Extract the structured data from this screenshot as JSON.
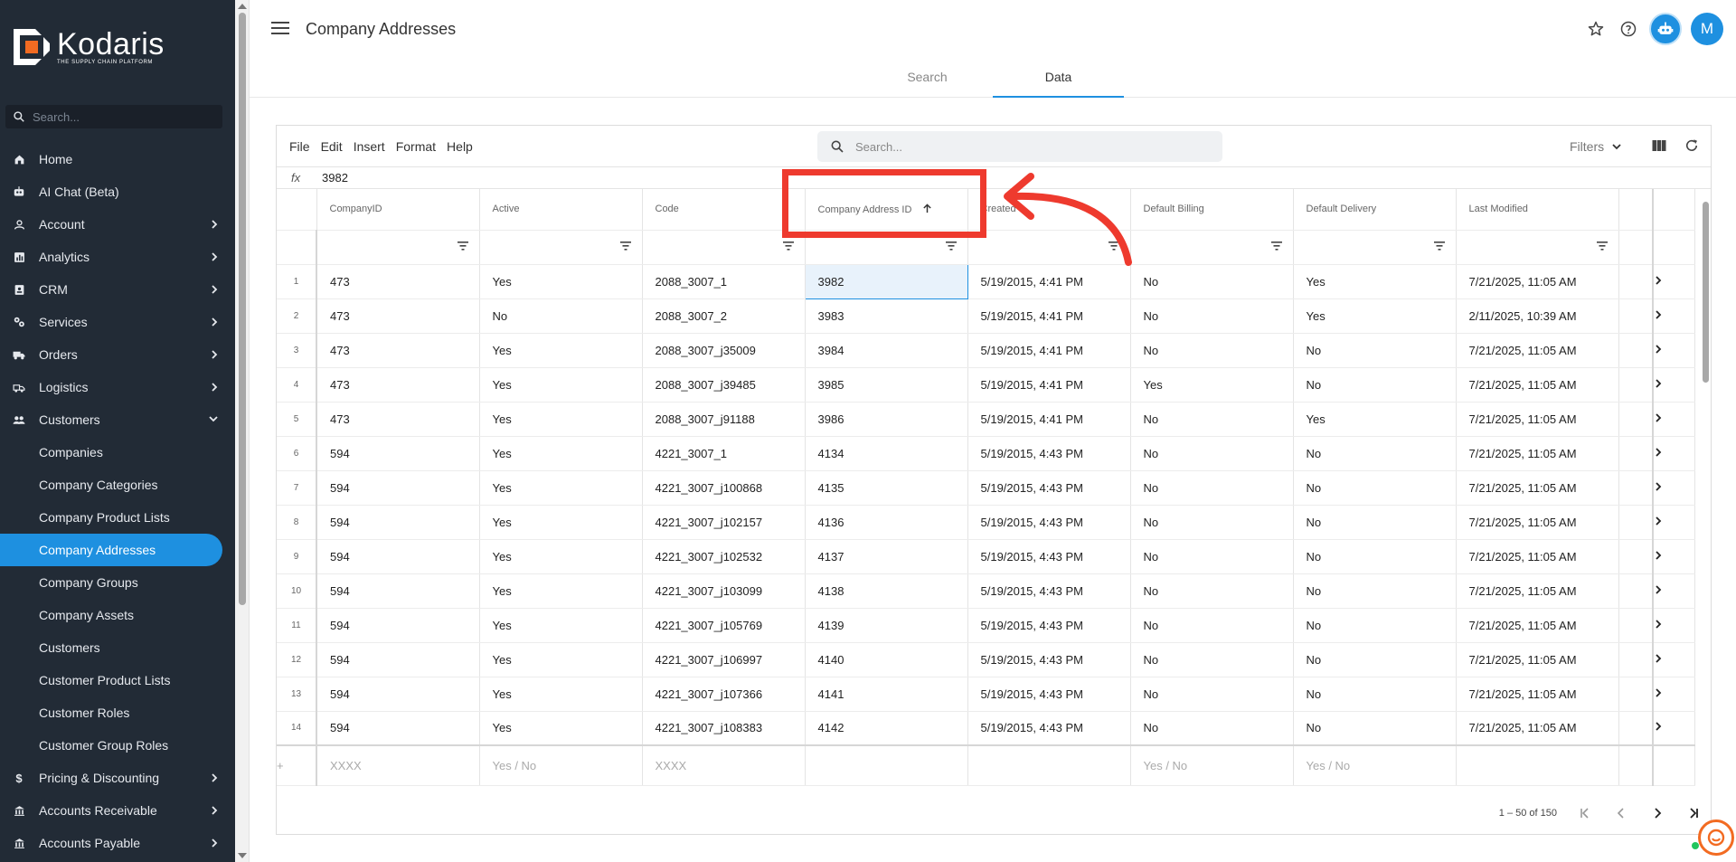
{
  "app": {
    "brand": "Kodaris",
    "tagline": "THE SUPPLY CHAIN PLATFORM",
    "accent_color": "#1e90e0",
    "annotation_color": "#ee3a2e"
  },
  "sidebar": {
    "search_placeholder": "Search...",
    "items": [
      {
        "label": "Home",
        "icon": "home-icon"
      },
      {
        "label": "AI Chat (Beta)",
        "icon": "robot-icon"
      },
      {
        "label": "Account",
        "icon": "user-icon"
      },
      {
        "label": "Analytics",
        "icon": "chart-icon"
      },
      {
        "label": "CRM",
        "icon": "contact-icon"
      },
      {
        "label": "Services",
        "icon": "services-icon"
      },
      {
        "label": "Orders",
        "icon": "truck-icon"
      },
      {
        "label": "Logistics",
        "icon": "shipping-icon"
      },
      {
        "label": "Customers",
        "icon": "people-icon"
      }
    ],
    "sub_items": [
      {
        "label": "Companies"
      },
      {
        "label": "Company Categories"
      },
      {
        "label": "Company Product Lists"
      },
      {
        "label": "Company Addresses"
      },
      {
        "label": "Company Groups"
      },
      {
        "label": "Company Assets"
      },
      {
        "label": "Customers"
      },
      {
        "label": "Customer Product Lists"
      },
      {
        "label": "Customer Roles"
      },
      {
        "label": "Customer Group Roles"
      }
    ],
    "bottom_items": [
      {
        "label": "Pricing & Discounting",
        "icon": "dollar-icon"
      },
      {
        "label": "Accounts Receivable",
        "icon": "bank-icon"
      },
      {
        "label": "Accounts Payable",
        "icon": "bank-icon"
      }
    ]
  },
  "header": {
    "title": "Company Addresses",
    "avatar_initial": "M",
    "tabs": [
      {
        "label": "Search",
        "active": false
      },
      {
        "label": "Data",
        "active": true
      }
    ]
  },
  "toolbar": {
    "menus": [
      "File",
      "Edit",
      "Insert",
      "Format",
      "Help"
    ],
    "search_placeholder": "Search...",
    "filters_label": "Filters"
  },
  "formula_bar": {
    "label": "fx",
    "value": "3982"
  },
  "grid": {
    "columns": [
      "CompanyID",
      "Active",
      "Code",
      "Company Address ID",
      "Created",
      "Default Billing",
      "Default Delivery",
      "Last Modified"
    ],
    "sorted_column": "Company Address ID",
    "rows": [
      {
        "n": "1",
        "company_id": "473",
        "active": "Yes",
        "code": "2088_3007_1",
        "address_id": "3982",
        "created": "5/19/2015, 4:41 PM",
        "billing": "No",
        "delivery": "Yes",
        "modified": "7/21/2025, 11:05 AM"
      },
      {
        "n": "2",
        "company_id": "473",
        "active": "No",
        "code": "2088_3007_2",
        "address_id": "3983",
        "created": "5/19/2015, 4:41 PM",
        "billing": "No",
        "delivery": "Yes",
        "modified": "2/11/2025, 10:39 AM"
      },
      {
        "n": "3",
        "company_id": "473",
        "active": "Yes",
        "code": "2088_3007_j35009",
        "address_id": "3984",
        "created": "5/19/2015, 4:41 PM",
        "billing": "No",
        "delivery": "No",
        "modified": "7/21/2025, 11:05 AM"
      },
      {
        "n": "4",
        "company_id": "473",
        "active": "Yes",
        "code": "2088_3007_j39485",
        "address_id": "3985",
        "created": "5/19/2015, 4:41 PM",
        "billing": "Yes",
        "delivery": "No",
        "modified": "7/21/2025, 11:05 AM"
      },
      {
        "n": "5",
        "company_id": "473",
        "active": "Yes",
        "code": "2088_3007_j91188",
        "address_id": "3986",
        "created": "5/19/2015, 4:41 PM",
        "billing": "No",
        "delivery": "Yes",
        "modified": "7/21/2025, 11:05 AM"
      },
      {
        "n": "6",
        "company_id": "594",
        "active": "Yes",
        "code": "4221_3007_1",
        "address_id": "4134",
        "created": "5/19/2015, 4:43 PM",
        "billing": "No",
        "delivery": "No",
        "modified": "7/21/2025, 11:05 AM"
      },
      {
        "n": "7",
        "company_id": "594",
        "active": "Yes",
        "code": "4221_3007_j100868",
        "address_id": "4135",
        "created": "5/19/2015, 4:43 PM",
        "billing": "No",
        "delivery": "No",
        "modified": "7/21/2025, 11:05 AM"
      },
      {
        "n": "8",
        "company_id": "594",
        "active": "Yes",
        "code": "4221_3007_j102157",
        "address_id": "4136",
        "created": "5/19/2015, 4:43 PM",
        "billing": "No",
        "delivery": "No",
        "modified": "7/21/2025, 11:05 AM"
      },
      {
        "n": "9",
        "company_id": "594",
        "active": "Yes",
        "code": "4221_3007_j102532",
        "address_id": "4137",
        "created": "5/19/2015, 4:43 PM",
        "billing": "No",
        "delivery": "No",
        "modified": "7/21/2025, 11:05 AM"
      },
      {
        "n": "10",
        "company_id": "594",
        "active": "Yes",
        "code": "4221_3007_j103099",
        "address_id": "4138",
        "created": "5/19/2015, 4:43 PM",
        "billing": "No",
        "delivery": "No",
        "modified": "7/21/2025, 11:05 AM"
      },
      {
        "n": "11",
        "company_id": "594",
        "active": "Yes",
        "code": "4221_3007_j105769",
        "address_id": "4139",
        "created": "5/19/2015, 4:43 PM",
        "billing": "No",
        "delivery": "No",
        "modified": "7/21/2025, 11:05 AM"
      },
      {
        "n": "12",
        "company_id": "594",
        "active": "Yes",
        "code": "4221_3007_j106997",
        "address_id": "4140",
        "created": "5/19/2015, 4:43 PM",
        "billing": "No",
        "delivery": "No",
        "modified": "7/21/2025, 11:05 AM"
      },
      {
        "n": "13",
        "company_id": "594",
        "active": "Yes",
        "code": "4221_3007_j107366",
        "address_id": "4141",
        "created": "5/19/2015, 4:43 PM",
        "billing": "No",
        "delivery": "No",
        "modified": "7/21/2025, 11:05 AM"
      },
      {
        "n": "14",
        "company_id": "594",
        "active": "Yes",
        "code": "4221_3007_j108383",
        "address_id": "4142",
        "created": "5/19/2015, 4:43 PM",
        "billing": "No",
        "delivery": "No",
        "modified": "7/21/2025, 11:05 AM"
      }
    ],
    "new_row_placeholders": {
      "company_id": "XXXX",
      "active": "Yes / No",
      "code": "XXXX",
      "billing": "Yes / No",
      "delivery": "Yes / No"
    }
  },
  "pager": {
    "range_text": "1 – 50 of 150"
  }
}
